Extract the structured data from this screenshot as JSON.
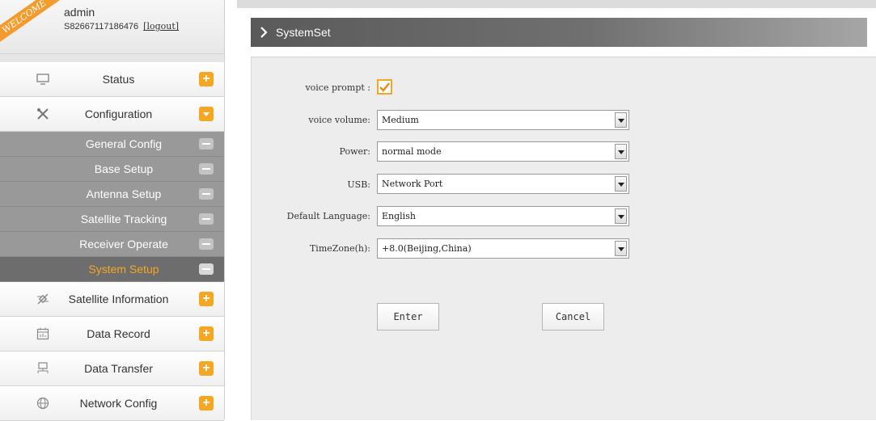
{
  "user_header": {
    "welcome": "WELCOME",
    "username": "admin",
    "serial": "S82667117186476",
    "logout_label": "[logout]"
  },
  "menu": {
    "status": {
      "label": "Status",
      "icon": "monitor-icon",
      "toggle": "+"
    },
    "configuration": {
      "label": "Configuration",
      "icon": "tools-icon",
      "toggle": "▾"
    },
    "sub_items": [
      {
        "label": "General Config"
      },
      {
        "label": "Base Setup"
      },
      {
        "label": "Antenna Setup"
      },
      {
        "label": "Satellite Tracking"
      },
      {
        "label": "Receiver Operate"
      },
      {
        "label": "System Setup",
        "active": true
      }
    ],
    "satellite_information": {
      "label": "Satellite Information",
      "icon": "satellite-icon",
      "toggle": "+"
    },
    "data_record": {
      "label": "Data Record",
      "icon": "calendar-icon",
      "toggle": "+"
    },
    "data_transfer": {
      "label": "Data Transfer",
      "icon": "network-icon",
      "toggle": "+"
    },
    "network_config": {
      "label": "Network Config",
      "icon": "globe-icon",
      "toggle": "+"
    }
  },
  "content": {
    "title": "SystemSet",
    "voice_prompt": {
      "label": "voice prompt :",
      "checked": true
    },
    "voice_volume": {
      "label": "voice volume:",
      "value": "Medium"
    },
    "power": {
      "label": "Power:",
      "value": "normal mode"
    },
    "usb": {
      "label": "USB:",
      "value": "Network Port"
    },
    "default_language": {
      "label": "Default Language:",
      "value": "English"
    },
    "timezone": {
      "label": "TimeZone(h):",
      "value": "+8.0(Beijing,China)"
    },
    "enter_label": "Enter",
    "cancel_label": "Cancel"
  },
  "colors": {
    "accent": "#f5a623",
    "header_dark": "#5a5a5a",
    "submenu": "#999999",
    "submenu_active": "#6d6d6d"
  }
}
